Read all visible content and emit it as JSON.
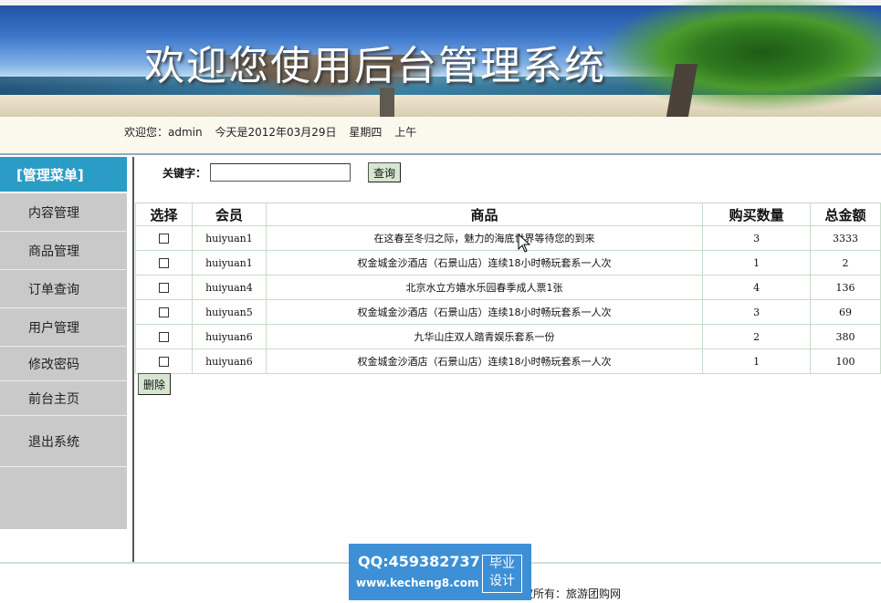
{
  "banner": {
    "title": "欢迎您使用后台管理系统"
  },
  "welcome": {
    "greeting": "欢迎您：admin",
    "date": "今天是2012年03月29日",
    "weekday": "星期四",
    "period": "上午"
  },
  "sidebar": {
    "header": "[管理菜单]",
    "items": [
      {
        "label": "内容管理"
      },
      {
        "label": "商品管理"
      },
      {
        "label": "订单查询"
      },
      {
        "label": "用户管理"
      },
      {
        "label": "修改密码"
      },
      {
        "label": "前台主页"
      },
      {
        "label": "退出系统"
      }
    ]
  },
  "search": {
    "label": "关键字：",
    "value": "",
    "button": "查询"
  },
  "table": {
    "headers": [
      "选择",
      "会员",
      "商品",
      "购买数量",
      "总金额"
    ],
    "rows": [
      {
        "member": "huiyuan1",
        "product": "在这春至冬归之际，魅力的海底世界等待您的到来",
        "qty": "3",
        "total": "3333"
      },
      {
        "member": "huiyuan1",
        "product": "权金城金沙酒店（石景山店）连续18小时畅玩套系一人次",
        "qty": "1",
        "total": "2"
      },
      {
        "member": "huiyuan4",
        "product": "北京水立方嬉水乐园春季成人票1张",
        "qty": "4",
        "total": "136"
      },
      {
        "member": "huiyuan5",
        "product": "权金城金沙酒店（石景山店）连续18小时畅玩套系一人次",
        "qty": "3",
        "total": "69"
      },
      {
        "member": "huiyuan6",
        "product": "九华山庄双人踏青娱乐套系一份",
        "qty": "2",
        "total": "380"
      },
      {
        "member": "huiyuan6",
        "product": "权金城金沙酒店（石景山店）连续18小时畅玩套系一人次",
        "qty": "1",
        "total": "100"
      }
    ],
    "delete_button": "删除"
  },
  "footer": {
    "copyright": "权所有：旅游团购网"
  },
  "watermark": {
    "qq": "QQ:459382737",
    "site": "www.kecheng8.com",
    "tag_line1": "毕业",
    "tag_line2": "设计"
  },
  "colors": {
    "sidebar_header": "#2b9cc6",
    "sidebar_bg": "#c9c9c9",
    "button_bg": "#d6e6d0",
    "watermark_bg": "#3d8fd6"
  }
}
